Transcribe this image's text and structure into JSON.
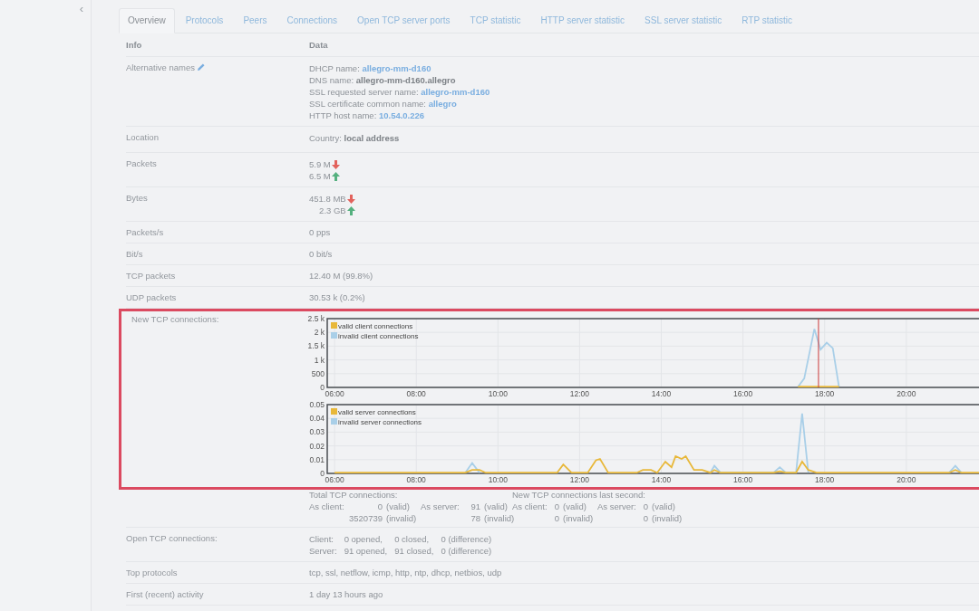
{
  "sidebar": {
    "collapse": "‹"
  },
  "tabs": [
    {
      "label": "Overview",
      "selected": true
    },
    {
      "label": "Protocols",
      "selected": false
    },
    {
      "label": "Peers",
      "selected": false
    },
    {
      "label": "Connections",
      "selected": false
    },
    {
      "label": "Open TCP server ports",
      "selected": false
    },
    {
      "label": "TCP statistic",
      "selected": false
    },
    {
      "label": "HTTP server statistic",
      "selected": false
    },
    {
      "label": "SSL server statistic",
      "selected": false
    },
    {
      "label": "RTP statistic",
      "selected": false
    }
  ],
  "table": {
    "columns": [
      "Info",
      "Data"
    ],
    "rows": [
      {
        "kind": "names",
        "label": "Alternative names",
        "highlighted": false,
        "lines": [
          {
            "label": "DHCP name:",
            "value": "allegro-mm-d160",
            "kind": "link"
          },
          {
            "label": "DNS name:",
            "value": "allegro-mm-d160.allegro",
            "kind": "bold"
          },
          {
            "label": "SSL requested server name:",
            "value": "allegro-mm-d160",
            "kind": "link"
          },
          {
            "label": "SSL certificate common name:",
            "value": "allegro",
            "kind": "link"
          },
          {
            "label": "HTTP host name:",
            "value": "10.54.0.226",
            "kind": "link"
          }
        ]
      },
      {
        "kind": "names",
        "label": "Location",
        "highlighted": false,
        "lines": [
          {
            "label": "Country:",
            "value": "local address",
            "kind": "bold"
          }
        ]
      },
      {
        "kind": "traffic",
        "label": "Packets",
        "highlighted": false,
        "lines": [
          {
            "value": "5.9 M",
            "kind": "down"
          },
          {
            "value": "6.5 M",
            "kind": "up"
          }
        ]
      },
      {
        "kind": "traffic",
        "label": "Bytes",
        "highlighted": false,
        "lines": [
          {
            "value": "451.8 MB",
            "kind": "down"
          },
          {
            "value": "2.3 GB",
            "kind": "up"
          }
        ]
      },
      {
        "kind": "text",
        "label": "Packets/s",
        "highlighted": false,
        "value": "0 pps"
      },
      {
        "kind": "text",
        "label": "Bit/s",
        "highlighted": false,
        "value": "0 bit/s"
      },
      {
        "kind": "text",
        "label": "TCP packets",
        "highlighted": false,
        "value": "12.40 M (99.8%)"
      },
      {
        "kind": "text",
        "label": "UDP packets",
        "highlighted": false,
        "value": "30.53 k (0.2%)"
      },
      {
        "kind": "charts",
        "label": "New TCP connections:",
        "highlighted": true,
        "charts": [
          {
            "chart_data": {
              "type": "line",
              "grid": true,
              "legend": true,
              "x": [
                17.35,
                17.5,
                17.75,
                17.9,
                18.05,
                18.2,
                18.35
              ],
              "xlim": [
                5.82,
                21.78
              ],
              "ylim": [
                0,
                2500
              ],
              "xticks": [
                {
                  "value": 6,
                  "label": "06:00"
                },
                {
                  "value": 8,
                  "label": "08:00"
                },
                {
                  "value": 10,
                  "label": "10:00"
                },
                {
                  "value": 12,
                  "label": "12:00"
                },
                {
                  "value": 14,
                  "label": "14:00"
                },
                {
                  "value": 16,
                  "label": "16:00"
                },
                {
                  "value": 18,
                  "label": "18:00"
                },
                {
                  "value": 20,
                  "label": "20:00"
                }
              ],
              "yticks": [
                0,
                500,
                {
                  "value": 1000,
                  "label": "1 k"
                },
                {
                  "value": 1500,
                  "label": "1.5 k"
                },
                {
                  "value": 2000,
                  "label": "2 k"
                },
                {
                  "value": 2500,
                  "label": "2.5 k"
                }
              ],
              "series": [
                {
                  "name": "valid client connections",
                  "color": "#e8b83a",
                  "values": [
                    0,
                    0,
                    0,
                    0,
                    0,
                    0,
                    0
                  ]
                },
                {
                  "name": "invalid client connections",
                  "color": "#a9cfe8",
                  "values": [
                    0,
                    300,
                    2100,
                    1350,
                    1600,
                    1400,
                    0
                  ]
                }
              ],
              "ref_lines": [
                {
                  "axis": "x",
                  "value": 17.85,
                  "color": "#cc3a3a"
                }
              ]
            }
          },
          {
            "chart_data": {
              "type": "line",
              "grid": true,
              "legend": true,
              "x": [
                6,
                9.2,
                9.37,
                9.55,
                9.7,
                11.45,
                11.6,
                11.8,
                12.2,
                12.4,
                12.5,
                12.7,
                13.4,
                13.55,
                13.75,
                13.9,
                14.1,
                14.25,
                14.35,
                14.5,
                14.6,
                14.8,
                15.0,
                15.2,
                15.3,
                15.45,
                16.75,
                16.9,
                17.05,
                17.3,
                17.45,
                17.6,
                17.8,
                21.05,
                21.2,
                21.35,
                21.78
              ],
              "xlim": [
                5.82,
                21.78
              ],
              "ylim": [
                0,
                0.05
              ],
              "xticks": [
                {
                  "value": 6,
                  "label": "06:00"
                },
                {
                  "value": 8,
                  "label": "08:00"
                },
                {
                  "value": 10,
                  "label": "10:00"
                },
                {
                  "value": 12,
                  "label": "12:00"
                },
                {
                  "value": 14,
                  "label": "14:00"
                },
                {
                  "value": 16,
                  "label": "16:00"
                },
                {
                  "value": 18,
                  "label": "18:00"
                },
                {
                  "value": 20,
                  "label": "20:00"
                }
              ],
              "yticks": [
                0,
                0.01,
                0.02,
                0.03,
                0.04,
                0.05
              ],
              "series": [
                {
                  "name": "valid server connections",
                  "color": "#e8b83a",
                  "values": [
                    0,
                    0,
                    0.002,
                    0.002,
                    0,
                    0,
                    0.006,
                    0,
                    0,
                    0.009,
                    0.01,
                    0,
                    0,
                    0.002,
                    0.002,
                    0,
                    0.008,
                    0.004,
                    0.012,
                    0.01,
                    0.012,
                    0.002,
                    0.002,
                    0,
                    0.002,
                    0,
                    0,
                    0.001,
                    0,
                    0,
                    0.008,
                    0.002,
                    0,
                    0,
                    0.002,
                    0,
                    0
                  ]
                },
                {
                  "name": "invalid server connections",
                  "color": "#a9cfe8",
                  "values": [
                    null,
                    0,
                    0.007,
                    0,
                    null,
                    null,
                    null,
                    null,
                    null,
                    null,
                    null,
                    null,
                    null,
                    null,
                    null,
                    null,
                    null,
                    null,
                    null,
                    null,
                    null,
                    null,
                    null,
                    0,
                    0.005,
                    0,
                    0,
                    0.004,
                    0,
                    0,
                    0.043,
                    0,
                    null,
                    0,
                    0.005,
                    0,
                    null
                  ]
                }
              ]
            }
          }
        ]
      },
      {
        "kind": "summary",
        "highlighted": false,
        "headings": [
          "Total TCP connections:",
          "New TCP connections last second:"
        ],
        "groups": [
          {
            "role": "As client:",
            "valid": "0",
            "valid_note": "(valid)",
            "invalid": "3520739",
            "invalid_note": "(invalid)"
          },
          {
            "role": "As server:",
            "valid": "91",
            "valid_note": "(valid)",
            "invalid": "78",
            "invalid_note": "(invalid)"
          },
          {
            "role": "As client:",
            "valid": "0",
            "valid_note": "(valid)",
            "invalid": "0",
            "invalid_note": "(invalid)"
          },
          {
            "role": "As server:",
            "valid": "0",
            "valid_note": "(valid)",
            "invalid": "0",
            "invalid_note": "(invalid)"
          }
        ]
      },
      {
        "kind": "grid",
        "label": "Open TCP connections:",
        "highlighted": false,
        "lines": [
          [
            "Client:",
            "0 opened,",
            "0 closed,",
            "0 (difference)"
          ],
          [
            "Server:",
            "91 opened,",
            "91 closed,",
            "0 (difference)"
          ]
        ]
      },
      {
        "kind": "text",
        "label": "Top protocols",
        "highlighted": false,
        "value": "tcp, ssl, netflow, icmp, http, ntp, dhcp, netbios, udp"
      },
      {
        "kind": "text",
        "label": "First (recent) activity",
        "highlighted": false,
        "value": "1 day 13 hours ago"
      }
    ]
  }
}
